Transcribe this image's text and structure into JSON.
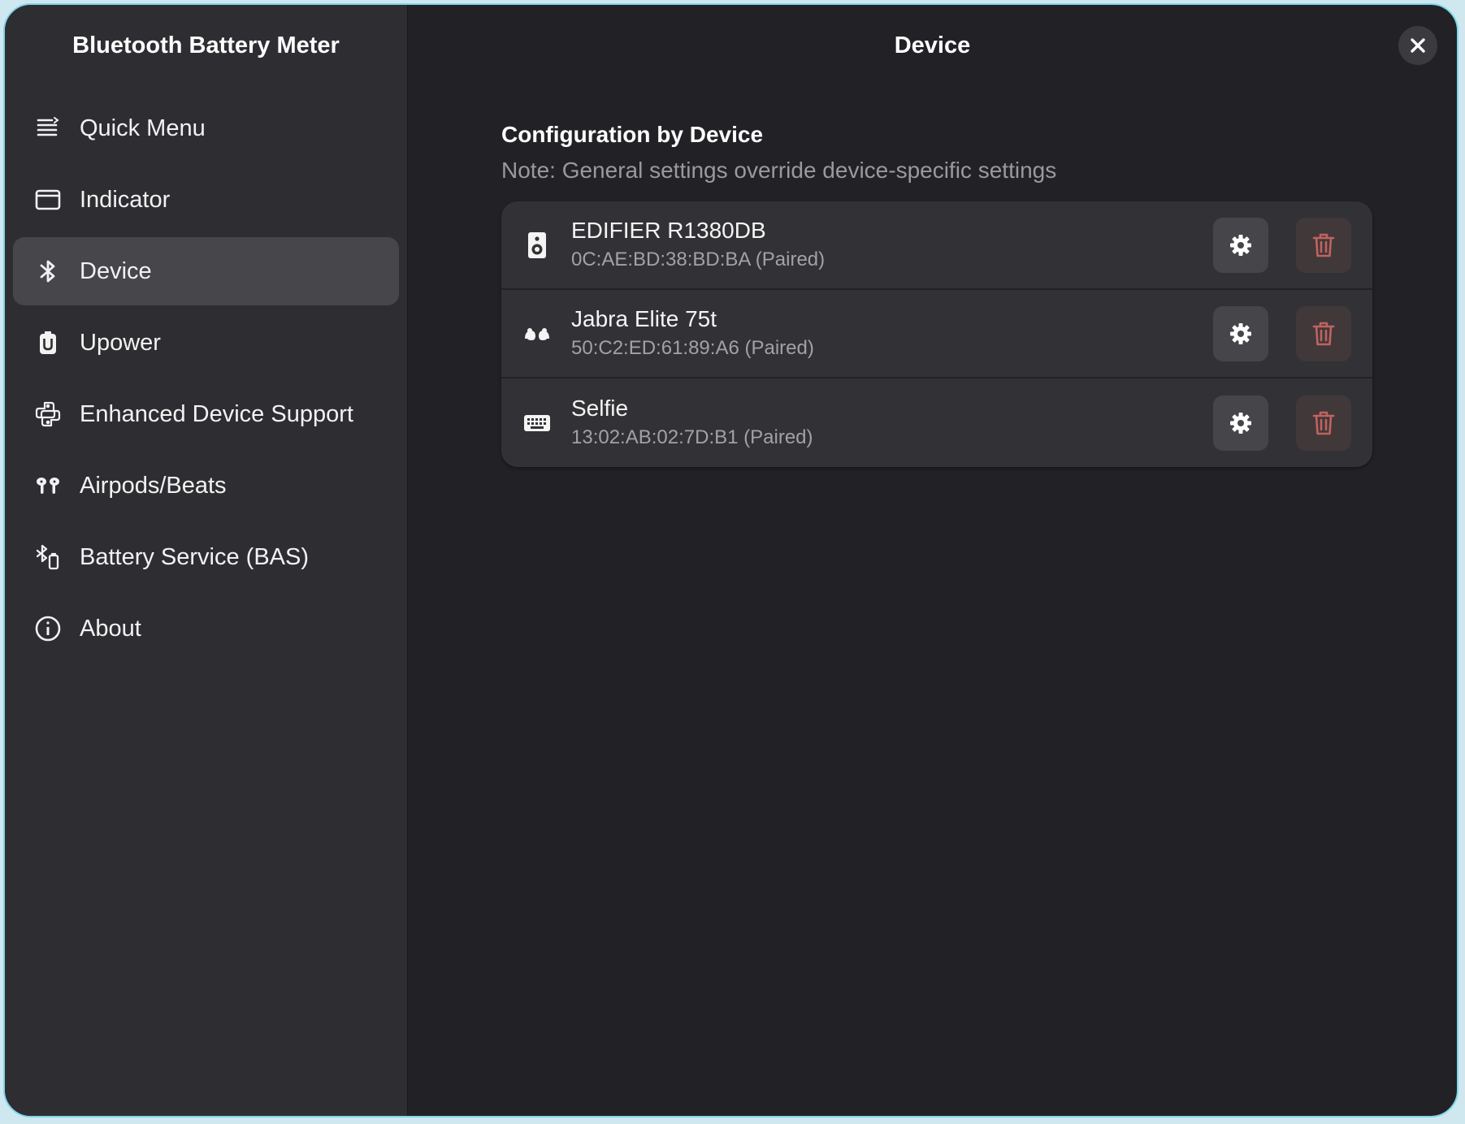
{
  "sidebar": {
    "title": "Bluetooth Battery Meter",
    "items": [
      {
        "label": "Quick Menu",
        "icon": "list-icon",
        "active": false
      },
      {
        "label": "Indicator",
        "icon": "indicator-icon",
        "active": false
      },
      {
        "label": "Device",
        "icon": "bluetooth-icon",
        "active": true
      },
      {
        "label": "Upower",
        "icon": "upower-icon",
        "active": false
      },
      {
        "label": "Enhanced Device Support",
        "icon": "python-icon",
        "active": false
      },
      {
        "label": "Airpods/Beats",
        "icon": "airpods-icon",
        "active": false
      },
      {
        "label": "Battery Service (BAS)",
        "icon": "bluetooth-battery-icon",
        "active": false
      },
      {
        "label": "About",
        "icon": "info-icon",
        "active": false
      }
    ]
  },
  "header": {
    "title": "Device"
  },
  "main": {
    "section_title": "Configuration by Device",
    "section_note": "Note: General settings override device-specific settings",
    "devices": [
      {
        "name": "EDIFIER R1380DB",
        "address": "0C:AE:BD:38:BD:BA (Paired)",
        "icon": "speaker-icon"
      },
      {
        "name": "Jabra Elite 75t",
        "address": "50:C2:ED:61:89:A6 (Paired)",
        "icon": "earbuds-icon"
      },
      {
        "name": "Selfie",
        "address": "13:02:AB:02:7D:B1 (Paired)",
        "icon": "keyboard-icon"
      }
    ]
  },
  "colors": {
    "window_bg": "#222226",
    "sidebar_bg": "#2e2e32",
    "active_item_bg": "#46464b",
    "card_bg": "#323236",
    "delete_icon": "#c0635f",
    "border_accent": "#7fd6ea"
  }
}
